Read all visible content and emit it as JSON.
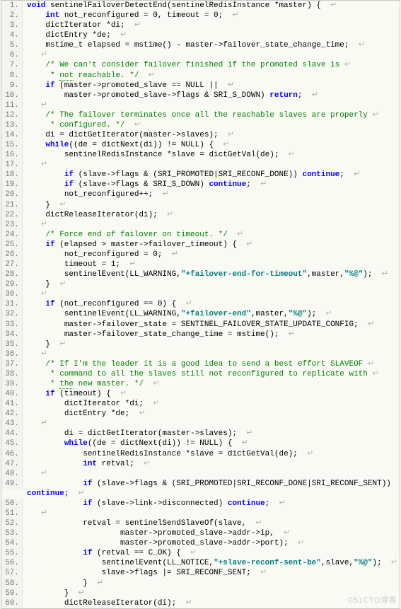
{
  "pilcrow": "↵",
  "watermark": "©51CTO博客",
  "lines": [
    {
      "n": "1.",
      "t": [
        [
          "kw",
          "void"
        ],
        [
          "p",
          " sentinelFailoverDetectEnd(sentinelRedisInstance *master) {  "
        ],
        [
          "pc",
          ""
        ]
      ]
    },
    {
      "n": "2.",
      "t": [
        [
          "p",
          "    "
        ],
        [
          "kw",
          "int"
        ],
        [
          "p",
          " not_reconfigured = 0, timeout = 0;  "
        ],
        [
          "pc",
          ""
        ]
      ]
    },
    {
      "n": "3.",
      "t": [
        [
          "p",
          "    dictIterator *di;  "
        ],
        [
          "pc",
          ""
        ]
      ]
    },
    {
      "n": "4.",
      "t": [
        [
          "p",
          "    dictEntry *de;  "
        ],
        [
          "pc",
          ""
        ]
      ]
    },
    {
      "n": "5.",
      "t": [
        [
          "p",
          "    mstime_t elapsed = mstime() - master->failover_state_change_time;  "
        ],
        [
          "pc",
          ""
        ]
      ]
    },
    {
      "n": "6.",
      "t": [
        [
          "p",
          "   "
        ],
        [
          "pc",
          ""
        ]
      ]
    },
    {
      "n": "7.",
      "t": [
        [
          "p",
          "    "
        ],
        [
          "cmt",
          "/* We can't consider failover finished if the promoted slave is "
        ],
        [
          "pc",
          ""
        ]
      ]
    },
    {
      "n": "8.",
      "t": [
        [
          "p",
          "    "
        ],
        [
          "cmt",
          " * "
        ],
        [
          "cmtd",
          "not"
        ],
        [
          "cmt",
          " reachable. */"
        ],
        [
          "p",
          "  "
        ],
        [
          "pc",
          ""
        ]
      ]
    },
    {
      "n": "9.",
      "t": [
        [
          "p",
          "    "
        ],
        [
          "kw",
          "if"
        ],
        [
          "p",
          " (master->promoted_slave == NULL ||  "
        ],
        [
          "pc",
          ""
        ]
      ]
    },
    {
      "n": "10.",
      "t": [
        [
          "p",
          "        master->promoted_slave->flags & SRI_S_DOWN) "
        ],
        [
          "kw",
          "return"
        ],
        [
          "p",
          ";  "
        ],
        [
          "pc",
          ""
        ]
      ]
    },
    {
      "n": "11.",
      "t": [
        [
          "p",
          "   "
        ],
        [
          "pc",
          ""
        ]
      ]
    },
    {
      "n": "12.",
      "t": [
        [
          "p",
          "    "
        ],
        [
          "cmt",
          "/* The failover terminates once all the reachable slaves are properly "
        ],
        [
          "pc",
          ""
        ]
      ]
    },
    {
      "n": "13.",
      "t": [
        [
          "p",
          "    "
        ],
        [
          "cmt",
          " * configured. */"
        ],
        [
          "p",
          "  "
        ],
        [
          "pc",
          ""
        ]
      ]
    },
    {
      "n": "14.",
      "t": [
        [
          "p",
          "    di = dictGetIterator(master->slaves);  "
        ],
        [
          "pc",
          ""
        ]
      ]
    },
    {
      "n": "15.",
      "t": [
        [
          "p",
          "    "
        ],
        [
          "kw",
          "while"
        ],
        [
          "p",
          "((de = dictNext(di)) != NULL) {  "
        ],
        [
          "pc",
          ""
        ]
      ]
    },
    {
      "n": "16.",
      "t": [
        [
          "p",
          "        sentinelRedisInstance *slave = dictGetVal(de);  "
        ],
        [
          "pc",
          ""
        ]
      ]
    },
    {
      "n": "17.",
      "t": [
        [
          "p",
          "   "
        ],
        [
          "pc",
          ""
        ]
      ]
    },
    {
      "n": "18.",
      "t": [
        [
          "p",
          "        "
        ],
        [
          "kw",
          "if"
        ],
        [
          "p",
          " (slave->flags & (SRI_PROMOTED|SRI_RECONF_DONE)) "
        ],
        [
          "kw",
          "continue"
        ],
        [
          "p",
          ";  "
        ],
        [
          "pc",
          ""
        ]
      ]
    },
    {
      "n": "19.",
      "t": [
        [
          "p",
          "        "
        ],
        [
          "kw",
          "if"
        ],
        [
          "p",
          " (slave->flags & SRI_S_DOWN) "
        ],
        [
          "kw",
          "continue"
        ],
        [
          "p",
          ";  "
        ],
        [
          "pc",
          ""
        ]
      ]
    },
    {
      "n": "20.",
      "t": [
        [
          "p",
          "        not_reconfigured++;  "
        ],
        [
          "pc",
          ""
        ]
      ]
    },
    {
      "n": "21.",
      "t": [
        [
          "p",
          "    }  "
        ],
        [
          "pc",
          ""
        ]
      ]
    },
    {
      "n": "22.",
      "t": [
        [
          "p",
          "    dictReleaseIterator(di);  "
        ],
        [
          "pc",
          ""
        ]
      ]
    },
    {
      "n": "23.",
      "t": [
        [
          "p",
          "   "
        ],
        [
          "pc",
          ""
        ]
      ]
    },
    {
      "n": "24.",
      "t": [
        [
          "p",
          "    "
        ],
        [
          "cmt",
          "/* Force end of failover on timeout. */"
        ],
        [
          "p",
          "  "
        ],
        [
          "pc",
          ""
        ]
      ]
    },
    {
      "n": "25.",
      "t": [
        [
          "p",
          "    "
        ],
        [
          "kw",
          "if"
        ],
        [
          "p",
          " (elapsed > master->failover_timeout) {  "
        ],
        [
          "pc",
          ""
        ]
      ]
    },
    {
      "n": "26.",
      "t": [
        [
          "p",
          "        not_reconfigured = 0;  "
        ],
        [
          "pc",
          ""
        ]
      ]
    },
    {
      "n": "27.",
      "t": [
        [
          "p",
          "        timeout = 1;  "
        ],
        [
          "pc",
          ""
        ]
      ]
    },
    {
      "n": "28.",
      "t": [
        [
          "p",
          "        sentinelEvent(LL_WARNING,"
        ],
        [
          "str",
          "\"+failover-end-for-timeout\""
        ],
        [
          "p",
          ",master,"
        ],
        [
          "str",
          "\"%@\""
        ],
        [
          "p",
          ");  "
        ],
        [
          "pc",
          ""
        ]
      ]
    },
    {
      "n": "29.",
      "t": [
        [
          "p",
          "    }  "
        ],
        [
          "pc",
          ""
        ]
      ]
    },
    {
      "n": "30.",
      "t": [
        [
          "p",
          "   "
        ],
        [
          "pc",
          ""
        ]
      ]
    },
    {
      "n": "31.",
      "t": [
        [
          "p",
          "    "
        ],
        [
          "kw",
          "if"
        ],
        [
          "p",
          " (not_reconfigured == 0) {  "
        ],
        [
          "pc",
          ""
        ]
      ]
    },
    {
      "n": "32.",
      "t": [
        [
          "p",
          "        sentinelEvent(LL_WARNING,"
        ],
        [
          "str",
          "\"+failover-end\""
        ],
        [
          "p",
          ",master,"
        ],
        [
          "str",
          "\"%@\""
        ],
        [
          "p",
          ");  "
        ],
        [
          "pc",
          ""
        ]
      ]
    },
    {
      "n": "33.",
      "t": [
        [
          "p",
          "        master->failover_state = SENTINEL_FAILOVER_STATE_UPDATE_CONFIG;  "
        ],
        [
          "pc",
          ""
        ]
      ]
    },
    {
      "n": "34.",
      "t": [
        [
          "p",
          "        master->failover_state_change_time = mstime();  "
        ],
        [
          "pc",
          ""
        ]
      ]
    },
    {
      "n": "35.",
      "t": [
        [
          "p",
          "    }  "
        ],
        [
          "pc",
          ""
        ]
      ]
    },
    {
      "n": "36.",
      "t": [
        [
          "p",
          "   "
        ],
        [
          "pc",
          ""
        ]
      ]
    },
    {
      "n": "37.",
      "t": [
        [
          "p",
          "    "
        ],
        [
          "cmt",
          "/* If I'm the leader it is a good idea to send a best effort SLAVEOF "
        ],
        [
          "pc",
          ""
        ]
      ]
    },
    {
      "n": "38.",
      "t": [
        [
          "p",
          "    "
        ],
        [
          "cmt",
          " * command to all the slaves still not reconfigured to replicate with "
        ],
        [
          "pc",
          ""
        ]
      ]
    },
    {
      "n": "39.",
      "t": [
        [
          "p",
          "    "
        ],
        [
          "cmt",
          " * "
        ],
        [
          "cmtd",
          "the"
        ],
        [
          "cmt",
          " new master. */"
        ],
        [
          "p",
          "  "
        ],
        [
          "pc",
          ""
        ]
      ]
    },
    {
      "n": "40.",
      "t": [
        [
          "p",
          "    "
        ],
        [
          "kw",
          "if"
        ],
        [
          "p",
          " (timeout) {  "
        ],
        [
          "pc",
          ""
        ]
      ]
    },
    {
      "n": "41.",
      "t": [
        [
          "p",
          "        dictIterator *di;  "
        ],
        [
          "pc",
          ""
        ]
      ]
    },
    {
      "n": "42.",
      "t": [
        [
          "p",
          "        dictEntry *de;  "
        ],
        [
          "pc",
          ""
        ]
      ]
    },
    {
      "n": "43.",
      "t": [
        [
          "p",
          "   "
        ],
        [
          "pc",
          ""
        ]
      ]
    },
    {
      "n": "44.",
      "t": [
        [
          "p",
          "        di = dictGetIterator(master->slaves);  "
        ],
        [
          "pc",
          ""
        ]
      ]
    },
    {
      "n": "45.",
      "t": [
        [
          "p",
          "        "
        ],
        [
          "kw",
          "while"
        ],
        [
          "p",
          "((de = dictNext(di)) != NULL) {  "
        ],
        [
          "pc",
          ""
        ]
      ]
    },
    {
      "n": "46.",
      "t": [
        [
          "p",
          "            sentinelRedisInstance *slave = dictGetVal(de);  "
        ],
        [
          "pc",
          ""
        ]
      ]
    },
    {
      "n": "47.",
      "t": [
        [
          "p",
          "            "
        ],
        [
          "kw",
          "int"
        ],
        [
          "p",
          " retval;  "
        ],
        [
          "pc",
          ""
        ]
      ]
    },
    {
      "n": "48.",
      "t": [
        [
          "p",
          "   "
        ],
        [
          "pc",
          ""
        ]
      ]
    },
    {
      "n": "49.",
      "t": [
        [
          "p",
          "            "
        ],
        [
          "kw",
          "if"
        ],
        [
          "p",
          " (slave->flags & (SRI_PROMOTED|SRI_RECONF_DONE|SRI_RECONF_SENT)) "
        ],
        [
          "kw",
          "continue"
        ],
        [
          "p",
          ";  "
        ],
        [
          "pc",
          ""
        ]
      ]
    },
    {
      "n": "50.",
      "t": [
        [
          "p",
          "            "
        ],
        [
          "kw",
          "if"
        ],
        [
          "p",
          " (slave->link->disconnected) "
        ],
        [
          "kw",
          "continue"
        ],
        [
          "p",
          ";  "
        ],
        [
          "pc",
          ""
        ]
      ]
    },
    {
      "n": "51.",
      "t": [
        [
          "p",
          "   "
        ],
        [
          "pc",
          ""
        ]
      ]
    },
    {
      "n": "52.",
      "t": [
        [
          "p",
          "            retval = sentinelSendSlaveOf(slave,  "
        ],
        [
          "pc",
          ""
        ]
      ]
    },
    {
      "n": "53.",
      "t": [
        [
          "p",
          "                    master->promoted_slave->addr->ip,  "
        ],
        [
          "pc",
          ""
        ]
      ]
    },
    {
      "n": "54.",
      "t": [
        [
          "p",
          "                    master->promoted_slave->addr->port);  "
        ],
        [
          "pc",
          ""
        ]
      ]
    },
    {
      "n": "55.",
      "t": [
        [
          "p",
          "            "
        ],
        [
          "kw",
          "if"
        ],
        [
          "p",
          " (retval == C_OK) {  "
        ],
        [
          "pc",
          ""
        ]
      ]
    },
    {
      "n": "56.",
      "t": [
        [
          "p",
          "                sentinelEvent(LL_NOTICE,"
        ],
        [
          "str",
          "\"+slave-reconf-sent-be\""
        ],
        [
          "p",
          ",slave,"
        ],
        [
          "str",
          "\"%@\""
        ],
        [
          "p",
          ");  "
        ],
        [
          "pc",
          ""
        ]
      ]
    },
    {
      "n": "57.",
      "t": [
        [
          "p",
          "                slave->flags |= SRI_RECONF_SENT;  "
        ],
        [
          "pc",
          ""
        ]
      ]
    },
    {
      "n": "58.",
      "t": [
        [
          "p",
          "            }  "
        ],
        [
          "pc",
          ""
        ]
      ]
    },
    {
      "n": "59.",
      "t": [
        [
          "p",
          "        }  "
        ],
        [
          "pc",
          ""
        ]
      ]
    },
    {
      "n": "60.",
      "t": [
        [
          "p",
          "        dictReleaseIterator(di);  "
        ],
        [
          "pc",
          ""
        ]
      ]
    }
  ]
}
